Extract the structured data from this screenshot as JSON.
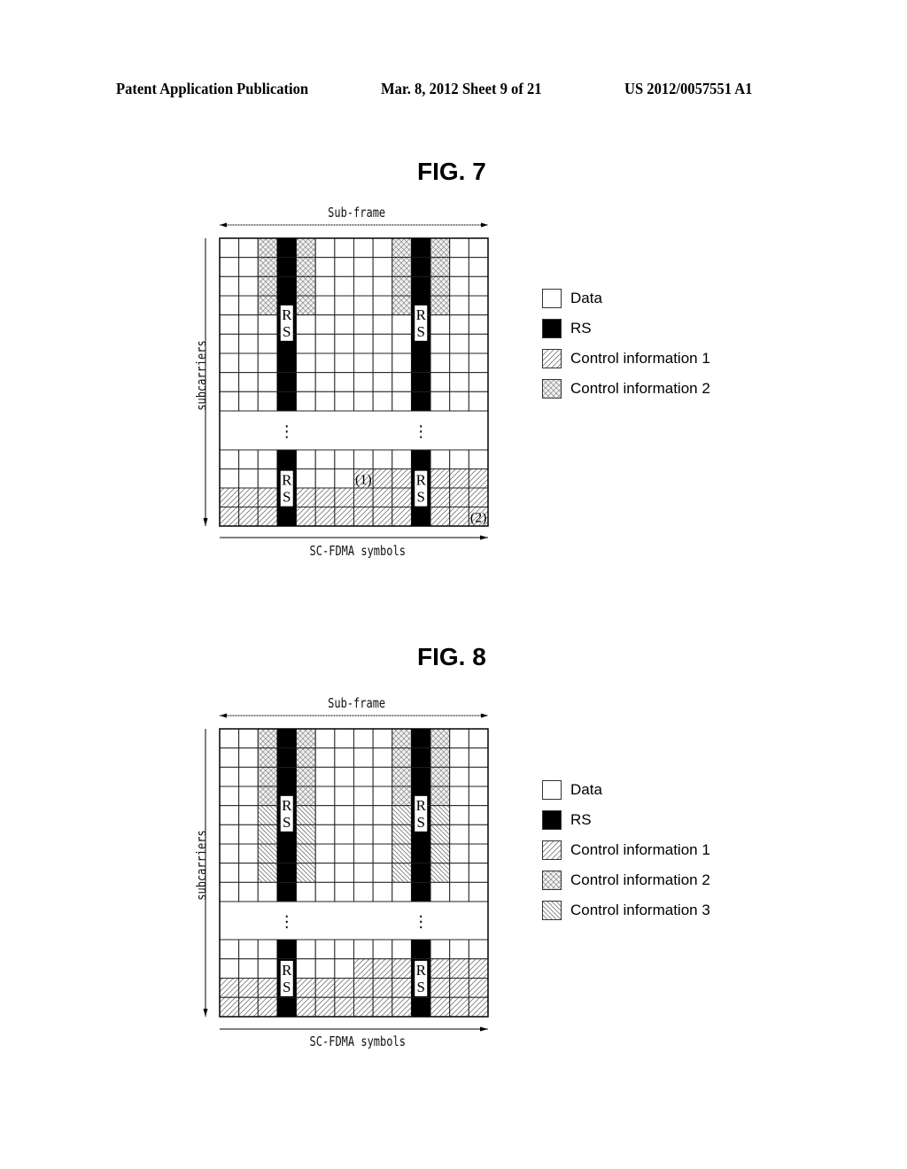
{
  "header": {
    "publication": "Patent Application Publication",
    "date_sheet": "Mar. 8, 2012   Sheet 9 of 21",
    "number": "US 2012/0057551 A1"
  },
  "legend_labels": {
    "data": "Data",
    "rs": "RS",
    "ci1": "Control information 1",
    "ci2": "Control information 2",
    "ci3": "Control information 3"
  },
  "figures": [
    {
      "title": "FIG. 7",
      "top_label": "Sub-frame",
      "bottom_label": "SC-FDMA symbols",
      "side_label": "subcarriers",
      "columns": 14,
      "rs_columns": [
        3,
        10
      ],
      "rs_text": [
        "R",
        "S"
      ],
      "ellipsis": "⋮",
      "top_rows": [
        [
          "d",
          "d",
          "c2",
          "rs",
          "c2",
          "d",
          "d",
          "d",
          "d",
          "c2",
          "rs",
          "c2",
          "d",
          "d"
        ],
        [
          "d",
          "d",
          "c2",
          "rs",
          "c2",
          "d",
          "d",
          "d",
          "d",
          "c2",
          "rs",
          "c2",
          "d",
          "d"
        ],
        [
          "d",
          "d",
          "c2",
          "rs",
          "c2",
          "d",
          "d",
          "d",
          "d",
          "c2",
          "rs",
          "c2",
          "d",
          "d"
        ],
        [
          "d",
          "d",
          "c2",
          "rs",
          "c2",
          "d",
          "d",
          "d",
          "d",
          "c2",
          "rs",
          "c2",
          "d",
          "d"
        ],
        [
          "d",
          "d",
          "d",
          "rs",
          "d",
          "d",
          "d",
          "d",
          "d",
          "d",
          "rs",
          "d",
          "d",
          "d"
        ],
        [
          "d",
          "d",
          "d",
          "rs",
          "d",
          "d",
          "d",
          "d",
          "d",
          "d",
          "rs",
          "d",
          "d",
          "d"
        ],
        [
          "d",
          "d",
          "d",
          "rs",
          "d",
          "d",
          "d",
          "d",
          "d",
          "d",
          "rs",
          "d",
          "d",
          "d"
        ],
        [
          "d",
          "d",
          "d",
          "rs",
          "d",
          "d",
          "d",
          "d",
          "d",
          "d",
          "rs",
          "d",
          "d",
          "d"
        ],
        [
          "d",
          "d",
          "d",
          "rs",
          "d",
          "d",
          "d",
          "d",
          "d",
          "d",
          "rs",
          "d",
          "d",
          "d"
        ]
      ],
      "bottom_rows": [
        [
          "d",
          "d",
          "d",
          "rs",
          "d",
          "d",
          "d",
          "d",
          "d",
          "d",
          "rs",
          "d",
          "d",
          "d"
        ],
        [
          "d",
          "d",
          "d",
          "rs",
          "d",
          "d",
          "d",
          "c1",
          "c1",
          "c1",
          "rs",
          "c1",
          "c1",
          "c1"
        ],
        [
          "c1",
          "c1",
          "c1",
          "rs",
          "c1",
          "c1",
          "c1",
          "c1",
          "c1",
          "c1",
          "rs",
          "c1",
          "c1",
          "c1"
        ],
        [
          "c1",
          "c1",
          "c1",
          "rs",
          "c1",
          "c1",
          "c1",
          "c1",
          "c1",
          "c1",
          "rs",
          "c1",
          "c1",
          "c1"
        ]
      ],
      "annotations": [
        {
          "text": "(1)",
          "row": 1,
          "col": 7
        },
        {
          "text": "(2)",
          "row": 3,
          "col": 13
        }
      ],
      "legend": [
        "data",
        "rs",
        "ci1",
        "ci2"
      ]
    },
    {
      "title": "FIG. 8",
      "top_label": "Sub-frame",
      "bottom_label": "SC-FDMA symbols",
      "side_label": "subcarriers",
      "columns": 14,
      "rs_columns": [
        3,
        10
      ],
      "rs_text": [
        "R",
        "S"
      ],
      "ellipsis": "⋮",
      "top_rows": [
        [
          "d",
          "d",
          "c2",
          "rs",
          "c2",
          "d",
          "d",
          "d",
          "d",
          "c2",
          "rs",
          "c2",
          "d",
          "d"
        ],
        [
          "d",
          "d",
          "c2",
          "rs",
          "c2",
          "d",
          "d",
          "d",
          "d",
          "c2",
          "rs",
          "c2",
          "d",
          "d"
        ],
        [
          "d",
          "d",
          "c2",
          "rs",
          "c2",
          "d",
          "d",
          "d",
          "d",
          "c2",
          "rs",
          "c2",
          "d",
          "d"
        ],
        [
          "d",
          "d",
          "c2",
          "rs",
          "c2",
          "d",
          "d",
          "d",
          "d",
          "c2",
          "rs",
          "c2",
          "d",
          "d"
        ],
        [
          "d",
          "d",
          "c3",
          "rs",
          "c3",
          "d",
          "d",
          "d",
          "d",
          "c3",
          "rs",
          "c3",
          "d",
          "d"
        ],
        [
          "d",
          "d",
          "c3",
          "rs",
          "c3",
          "d",
          "d",
          "d",
          "d",
          "c3",
          "rs",
          "c3",
          "d",
          "d"
        ],
        [
          "d",
          "d",
          "c3",
          "rs",
          "c3",
          "d",
          "d",
          "d",
          "d",
          "c3",
          "rs",
          "c3",
          "d",
          "d"
        ],
        [
          "d",
          "d",
          "c3",
          "rs",
          "c3",
          "d",
          "d",
          "d",
          "d",
          "c3",
          "rs",
          "c3",
          "d",
          "d"
        ],
        [
          "d",
          "d",
          "d",
          "rs",
          "d",
          "d",
          "d",
          "d",
          "d",
          "d",
          "rs",
          "d",
          "d",
          "d"
        ]
      ],
      "bottom_rows": [
        [
          "d",
          "d",
          "d",
          "rs",
          "d",
          "d",
          "d",
          "d",
          "d",
          "d",
          "rs",
          "d",
          "d",
          "d"
        ],
        [
          "d",
          "d",
          "d",
          "rs",
          "d",
          "d",
          "d",
          "c1",
          "c1",
          "c1",
          "rs",
          "c1",
          "c1",
          "c1"
        ],
        [
          "c1",
          "c1",
          "c1",
          "rs",
          "c1",
          "c1",
          "c1",
          "c1",
          "c1",
          "c1",
          "rs",
          "c1",
          "c1",
          "c1"
        ],
        [
          "c1",
          "c1",
          "c1",
          "rs",
          "c1",
          "c1",
          "c1",
          "c1",
          "c1",
          "c1",
          "rs",
          "c1",
          "c1",
          "c1"
        ]
      ],
      "annotations": [],
      "legend": [
        "data",
        "rs",
        "ci1",
        "ci2",
        "ci3"
      ]
    }
  ]
}
